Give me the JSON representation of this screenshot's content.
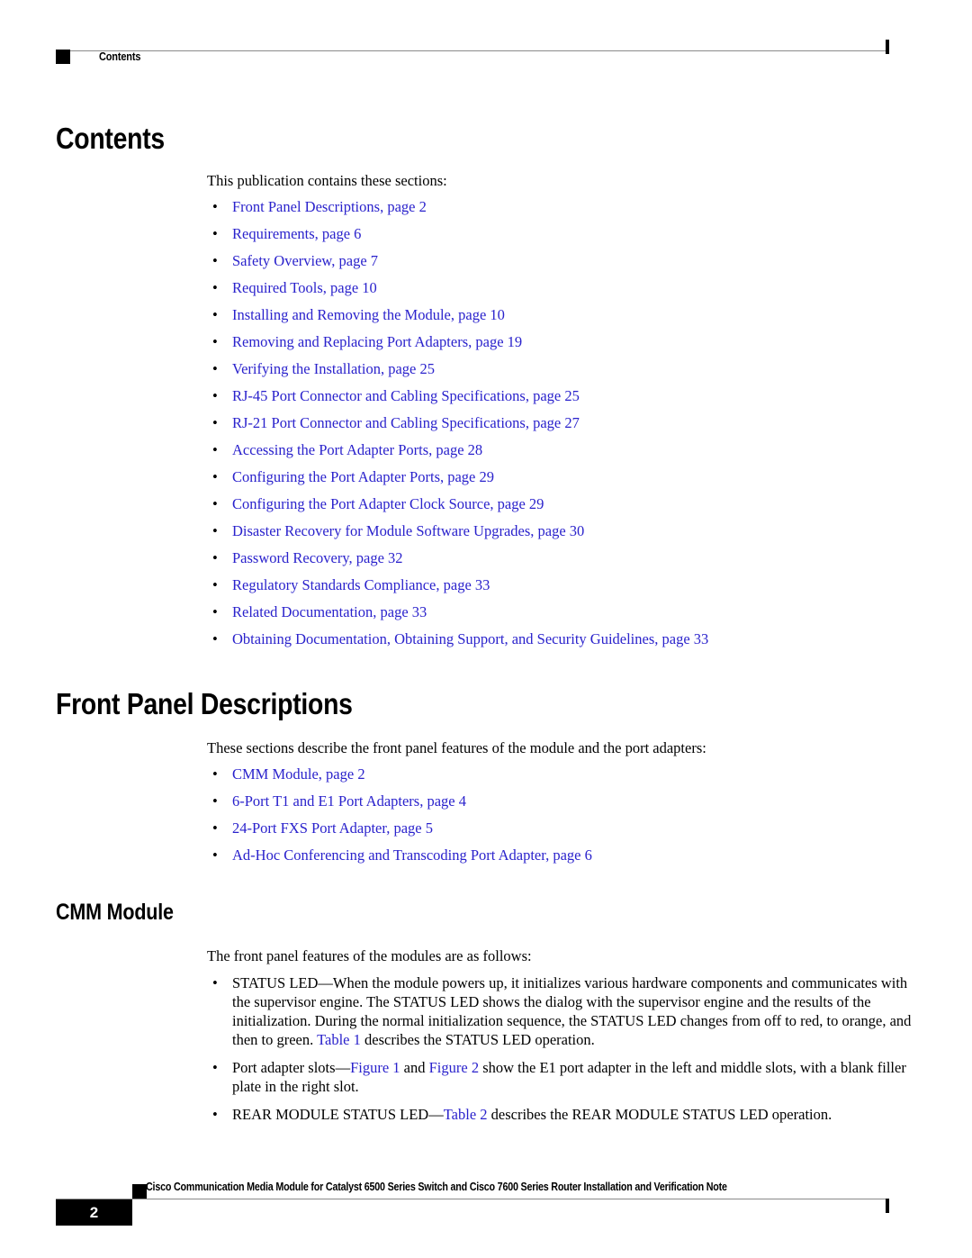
{
  "header": {
    "label": "Contents",
    "square_icon": "black-square-icon"
  },
  "sections": {
    "contents": {
      "heading": "Contents",
      "intro": "This publication contains these sections:",
      "items": [
        "Front Panel Descriptions, page 2",
        "Requirements, page 6",
        "Safety Overview, page 7",
        "Required Tools, page 10",
        "Installing and Removing the Module, page 10",
        "Removing and Replacing Port Adapters, page 19",
        "Verifying the Installation, page 25",
        "RJ-45 Port Connector and Cabling Specifications, page 25",
        "RJ-21 Port Connector and Cabling Specifications, page 27",
        "Accessing the Port Adapter Ports, page 28",
        "Configuring the Port Adapter Ports, page 29",
        "Configuring the Port Adapter Clock Source, page 29",
        "Disaster Recovery for Module Software Upgrades, page 30",
        "Password Recovery, page 32",
        "Regulatory Standards Compliance, page 33",
        "Related Documentation, page 33",
        "Obtaining Documentation, Obtaining Support, and Security Guidelines, page 33"
      ]
    },
    "front_panel": {
      "heading": "Front Panel Descriptions",
      "intro": "These sections describe the front panel features of the module and the port adapters:",
      "items": [
        "CMM Module, page 2",
        "6-Port T1 and E1 Port Adapters, page 4",
        "24-Port FXS Port Adapter, page 5",
        "Ad-Hoc Conferencing and Transcoding Port Adapter, page 6"
      ]
    },
    "cmm_module": {
      "heading": "CMM Module",
      "intro": "The front panel features of the modules are as follows:",
      "bullets": [
        {
          "parts": [
            {
              "text": "STATUS LED—When the module powers up, it initializes various hardware components and communicates with the supervisor engine. The STATUS LED shows the dialog with the supervisor engine and the results of the initialization. During the normal initialization sequence, the STATUS LED changes from off to red, to orange, and then to green. ",
              "link": false
            },
            {
              "text": "Table 1",
              "link": true
            },
            {
              "text": " describes the STATUS LED operation.",
              "link": false
            }
          ]
        },
        {
          "parts": [
            {
              "text": "Port adapter slots—",
              "link": false
            },
            {
              "text": "Figure 1",
              "link": true
            },
            {
              "text": " and ",
              "link": false
            },
            {
              "text": "Figure 2",
              "link": true
            },
            {
              "text": " show the E1 port adapter in the left and middle slots, with a blank filler plate in the right slot.",
              "link": false
            }
          ]
        },
        {
          "parts": [
            {
              "text": "REAR MODULE STATUS LED—",
              "link": false
            },
            {
              "text": "Table 2",
              "link": true
            },
            {
              "text": " describes the REAR MODULE STATUS LED operation.",
              "link": false
            }
          ]
        }
      ]
    }
  },
  "footer": {
    "page_number": "2",
    "document_title": "Cisco Communication Media Module for Catalyst 6500 Series Switch and Cisco 7600 Series Router Installation and Verification Note",
    "square_icon": "black-square-icon"
  },
  "colors": {
    "link": "#2a22cc",
    "rule": "#8a8a8a",
    "text": "#000000"
  },
  "bullet_glyph": "•"
}
